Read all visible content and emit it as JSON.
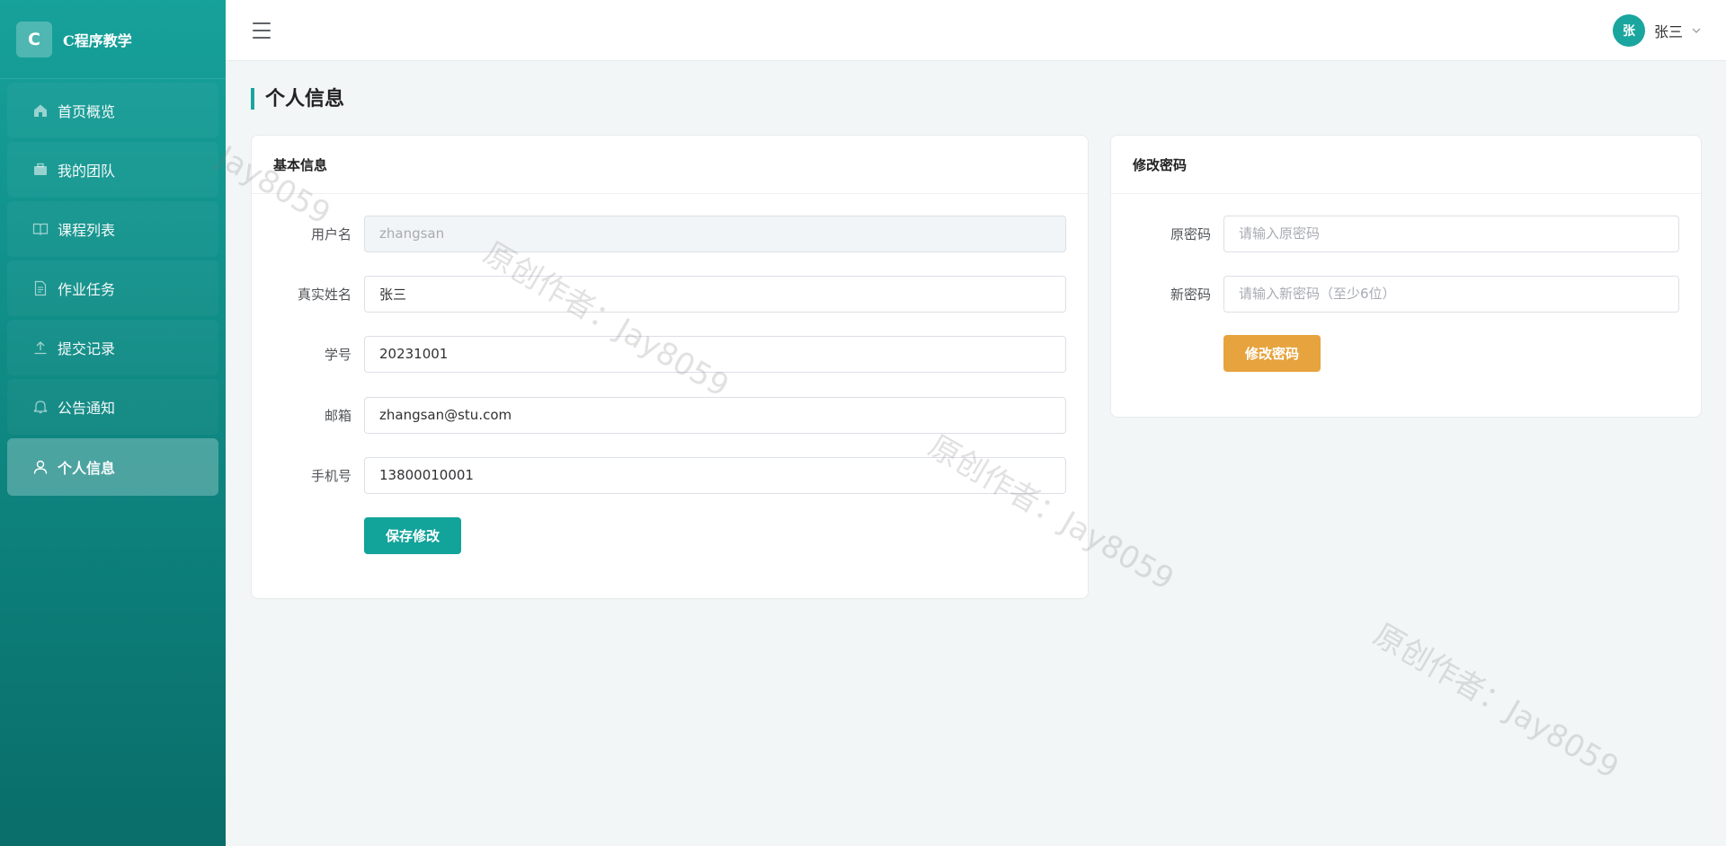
{
  "brand": {
    "logo_letter": "C",
    "title": "C程序教学"
  },
  "sidebar": {
    "items": [
      {
        "label": "首页概览",
        "icon": "home-icon"
      },
      {
        "label": "我的团队",
        "icon": "briefcase-icon"
      },
      {
        "label": "课程列表",
        "icon": "book-icon"
      },
      {
        "label": "作业任务",
        "icon": "document-icon"
      },
      {
        "label": "提交记录",
        "icon": "upload-icon"
      },
      {
        "label": "公告通知",
        "icon": "bell-icon"
      },
      {
        "label": "个人信息",
        "icon": "user-icon",
        "active": true
      }
    ]
  },
  "header": {
    "avatar_text": "张",
    "user_name": "张三"
  },
  "page": {
    "title": "个人信息"
  },
  "basic_info": {
    "title": "基本信息",
    "username_label": "用户名",
    "username_value": "zhangsan",
    "realname_label": "真实姓名",
    "realname_value": "张三",
    "student_id_label": "学号",
    "student_id_value": "20231001",
    "email_label": "邮箱",
    "email_value": "zhangsan@stu.com",
    "phone_label": "手机号",
    "phone_value": "13800010001",
    "save_label": "保存修改"
  },
  "password": {
    "title": "修改密码",
    "old_label": "原密码",
    "old_placeholder": "请输入原密码",
    "new_label": "新密码",
    "new_placeholder": "请输入新密码（至少6位）",
    "submit_label": "修改密码"
  },
  "watermark": {
    "text": "原创作者：Jay8059",
    "short_text": "Jay8059"
  },
  "colors": {
    "accent": "#12a39b",
    "warning": "#e7a33e",
    "sidebar": "#0e8782"
  }
}
